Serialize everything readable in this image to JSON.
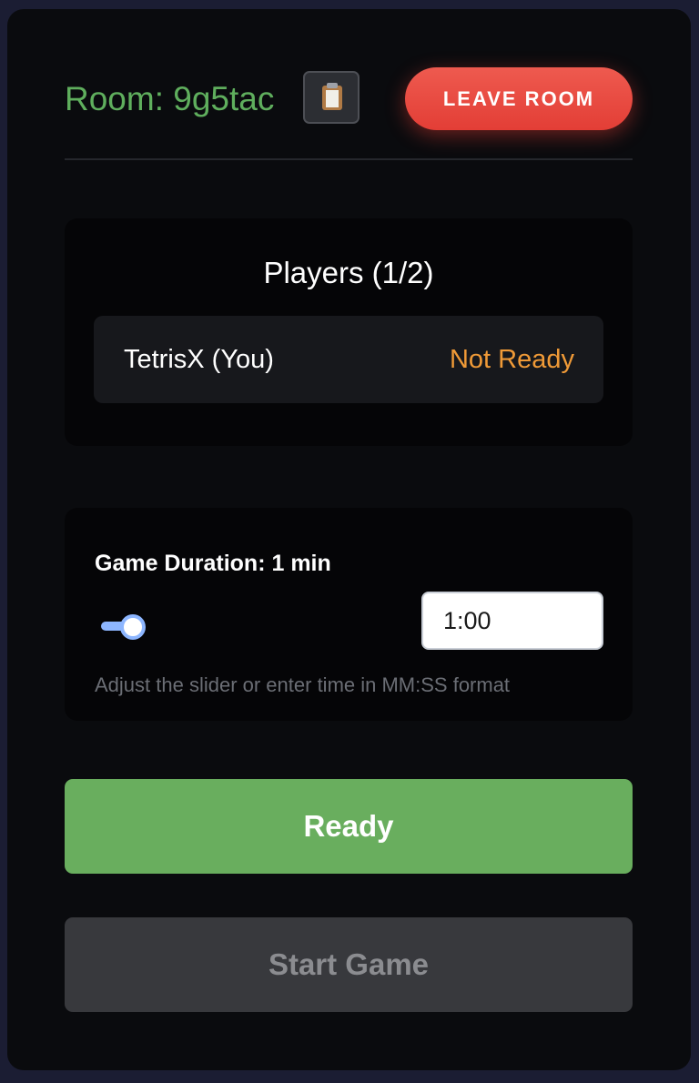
{
  "room": {
    "label": "Room: 9g5tac",
    "copy_icon": "clipboard-icon",
    "leave_label": "LEAVE ROOM"
  },
  "players": {
    "title": "Players (1/2)",
    "list": [
      {
        "name": "TetrisX (You)",
        "status": "Not Ready"
      }
    ]
  },
  "duration": {
    "title": "Game Duration: 1 min",
    "slider_value_fraction": 0.0,
    "input_value": "1:00",
    "hint": "Adjust the slider or enter time in MM:SS format"
  },
  "actions": {
    "ready_label": "Ready",
    "start_label": "Start Game"
  },
  "colors": {
    "background": "#1b1d33",
    "panel": "#0a0b0e",
    "room_label": "#5fae5d",
    "leave_button": "#e84b43",
    "status_not_ready": "#f09a37",
    "ready_button": "#69ae5e",
    "start_button_disabled": "#38393d",
    "slider_accent": "#8db6ff"
  }
}
